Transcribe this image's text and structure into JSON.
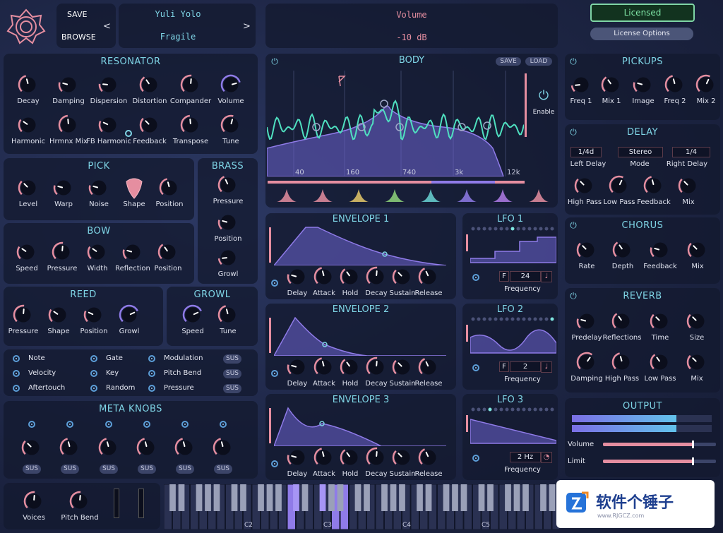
{
  "header": {
    "save_label": "SAVE",
    "browse_label": "BROWSE",
    "prev_arrow": "<",
    "next_arrow": ">",
    "preset_author": "Yuli Yolo",
    "preset_name": "Fragile",
    "param_name": "Volume",
    "param_value": "-10 dB",
    "licensed_label": "Licensed",
    "license_options_label": "License Options"
  },
  "resonator": {
    "title": "RESONATOR",
    "row1": [
      "Decay",
      "Damping",
      "Dispersion",
      "Distortion",
      "Compander",
      "Volume"
    ],
    "row2": [
      "Harmonic",
      "Hrmnx Mix",
      "FB Harmonic",
      "Feedback",
      "Transpose",
      "Tune"
    ]
  },
  "pick": {
    "title": "PICK",
    "labels": [
      "Level",
      "Warp",
      "Noise",
      "Shape",
      "Position"
    ]
  },
  "brass": {
    "title": "BRASS",
    "labels": [
      "Pressure",
      "Position",
      "Growl"
    ]
  },
  "bow": {
    "title": "BOW",
    "labels": [
      "Speed",
      "Pressure",
      "Width",
      "Reflection",
      "Position"
    ]
  },
  "reed": {
    "title": "REED",
    "labels": [
      "Pressure",
      "Shape",
      "Position",
      "Growl"
    ]
  },
  "growl": {
    "title": "GROWL",
    "labels": [
      "Speed",
      "Tune"
    ]
  },
  "modsources": {
    "col1": [
      "Note",
      "Velocity",
      "Aftertouch"
    ],
    "col2": [
      "Gate",
      "Key",
      "Random"
    ],
    "col3": [
      "Modulation",
      "Pitch Bend",
      "Pressure"
    ],
    "sus": "SUS"
  },
  "meta": {
    "title": "META KNOBS",
    "sus": "SUS"
  },
  "bottom": {
    "voices": "Voices",
    "pitch_bend": "Pitch Bend",
    "keys": [
      "C2",
      "C3",
      "C4",
      "C5"
    ]
  },
  "body": {
    "title": "BODY",
    "save": "SAVE",
    "load": "LOAD",
    "enable": "Enable",
    "freq_labels": [
      "40",
      "160",
      "740",
      "3k",
      "12k"
    ]
  },
  "env_labels": [
    "Delay",
    "Attack",
    "Hold",
    "Decay",
    "Sustain",
    "Release"
  ],
  "env1": {
    "title": "ENVELOPE 1"
  },
  "env2": {
    "title": "ENVELOPE 2"
  },
  "env3": {
    "title": "ENVELOPE 3"
  },
  "lfo1": {
    "title": "LFO 1",
    "mode": "F",
    "value": "24",
    "freq": "Frequency"
  },
  "lfo2": {
    "title": "LFO 2",
    "mode": "F",
    "value": "2",
    "freq": "Frequency"
  },
  "lfo3": {
    "title": "LFO 3",
    "value": "2 Hz",
    "freq": "Frequency"
  },
  "pickups": {
    "title": "PICKUPS",
    "labels": [
      "Freq 1",
      "Mix 1",
      "Image",
      "Freq 2",
      "Mix 2"
    ]
  },
  "delay": {
    "title": "DELAY",
    "left": "1/4d",
    "mode": "Stereo",
    "right": "1/4",
    "field_labels": [
      "Left Delay",
      "Mode",
      "Right Delay"
    ],
    "labels": [
      "High Pass",
      "Low Pass",
      "Feedback",
      "Mix"
    ]
  },
  "chorus": {
    "title": "CHORUS",
    "labels": [
      "Rate",
      "Depth",
      "Feedback",
      "Mix"
    ]
  },
  "reverb": {
    "title": "REVERB",
    "row1": [
      "Predelay",
      "Reflections",
      "Time",
      "Size"
    ],
    "row2": [
      "Damping",
      "High Pass",
      "Low Pass",
      "Mix"
    ]
  },
  "output": {
    "title": "OUTPUT",
    "volume": "Volume",
    "limit": "Limit"
  },
  "watermark": {
    "name": "软件个锤子",
    "url": "www.RJGCZ.com"
  }
}
